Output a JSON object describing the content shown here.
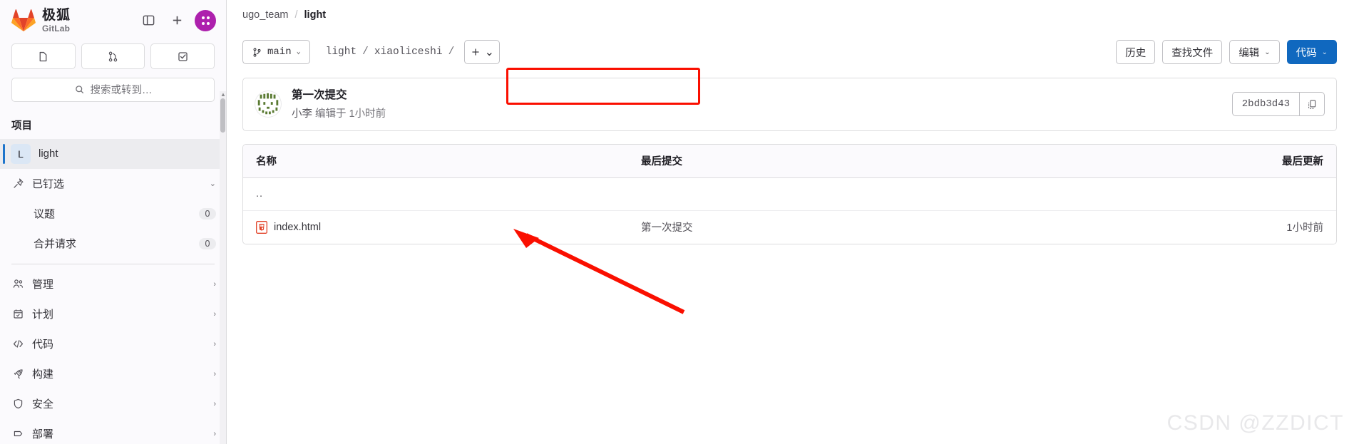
{
  "brand": {
    "cn": "极狐",
    "en": "GitLab"
  },
  "sidebar": {
    "top_actions": [
      {
        "name": "toggle-sidebar",
        "icon": "panel-icon"
      },
      {
        "name": "create-new",
        "icon": "plus-icon"
      }
    ],
    "avatar": "user-avatar",
    "quick_links": [
      {
        "name": "issues",
        "icon": "issue-icon"
      },
      {
        "name": "merge-requests",
        "icon": "merge-request-icon"
      },
      {
        "name": "todos",
        "icon": "todo-icon"
      }
    ],
    "search_placeholder": "搜索或转到…",
    "section_title": "项目",
    "project": {
      "initial": "L",
      "label": "light"
    },
    "items": [
      {
        "label": "已钉选",
        "icon": "pin-icon",
        "chevron": "⌄",
        "count": null
      },
      {
        "label": "议题",
        "icon": null,
        "count": "0",
        "sub": true
      },
      {
        "label": "合并请求",
        "icon": null,
        "count": "0",
        "sub": true
      },
      {
        "label": "管理",
        "icon": "users-icon",
        "chevron": "›",
        "count": null
      },
      {
        "label": "计划",
        "icon": "calendar-icon",
        "chevron": "›",
        "count": null
      },
      {
        "label": "代码",
        "icon": "code-icon",
        "chevron": "›",
        "count": null
      },
      {
        "label": "构建",
        "icon": "rocket-icon",
        "chevron": "›",
        "count": null
      },
      {
        "label": "安全",
        "icon": "shield-icon",
        "chevron": "›",
        "count": null
      },
      {
        "label": "部署",
        "icon": "deploy-icon",
        "chevron": "›",
        "count": null
      }
    ]
  },
  "breadcrumb": {
    "group": "ugo_team",
    "separator": "/",
    "project": "light"
  },
  "toolbar": {
    "branch": "main",
    "branch_chevron": "⌄",
    "path": [
      {
        "label": "light"
      },
      {
        "label": "xiaoliceshi"
      }
    ],
    "path_separator": "/",
    "add_label": "+",
    "add_chevron": "⌄",
    "history_label": "历史",
    "find_file_label": "查找文件",
    "edit_label": "编辑",
    "edit_chevron": "⌄",
    "code_label": "代码",
    "code_chevron": "⌄",
    "highlight_color": "#fa0f00",
    "primary_color": "#1068bf"
  },
  "commit": {
    "title": "第一次提交",
    "author": "小李",
    "meta": "编辑于 1小时前",
    "sha": "2bdb3d43",
    "copy_icon": "copy-icon"
  },
  "files": {
    "headers": {
      "name": "名称",
      "last_commit": "最后提交",
      "last_update": "最后更新"
    },
    "rows": [
      {
        "name": "..",
        "type": "parent",
        "last_commit": "",
        "last_update": ""
      },
      {
        "name": "index.html",
        "type": "file",
        "icon": "html-file-icon",
        "last_commit": "第一次提交",
        "last_update": "1小时前"
      }
    ]
  },
  "watermark": "CSDN @ZZDICT"
}
